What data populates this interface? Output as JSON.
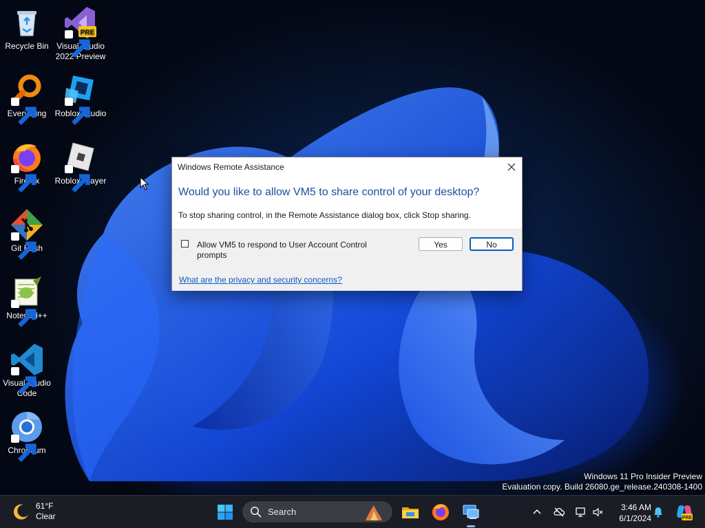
{
  "desktop_icons": [
    {
      "label": "Recycle Bin",
      "icon": "recycle-bin-icon"
    },
    {
      "label": "Visual Studio 2022 Preview",
      "icon": "visual-studio-icon",
      "badge": "PRE"
    },
    {
      "label": "Everything",
      "icon": "everything-search-icon"
    },
    {
      "label": "Roblox Studio",
      "icon": "roblox-studio-icon"
    },
    {
      "label": "Firefox",
      "icon": "firefox-icon"
    },
    {
      "label": "Roblox Player",
      "icon": "roblox-player-icon"
    },
    {
      "label": "Git Bash",
      "icon": "git-bash-icon"
    },
    {
      "label": "Notepad++",
      "icon": "notepad-plus-plus-icon"
    },
    {
      "label": "Visual Studio Code",
      "icon": "vscode-icon"
    },
    {
      "label": "Chromium",
      "icon": "chromium-icon"
    }
  ],
  "dialog": {
    "title": "Windows Remote Assistance",
    "question": "Would you like to allow VM5 to share control of your desktop?",
    "description": "To stop sharing control, in the Remote Assistance dialog box, click Stop sharing.",
    "checkbox_label": "Allow VM5 to respond to User Account Control prompts",
    "checkbox_checked": false,
    "yes_label": "Yes",
    "no_label": "No",
    "link_text": "What are the privacy and security concerns?"
  },
  "watermark": {
    "line1": "Windows 11 Pro Insider Preview",
    "line2": "Evaluation copy. Build 26080.ge_release.240308-1400"
  },
  "taskbar": {
    "weather_temp": "61°F",
    "weather_desc": "Clear",
    "search_placeholder": "Search",
    "time": "3:46 AM",
    "date": "6/1/2024",
    "copilot_badge": "PRE"
  },
  "colors": {
    "accent": "#005fb8",
    "question_blue": "#1a4fa0",
    "link_blue": "#0a5bc4"
  }
}
